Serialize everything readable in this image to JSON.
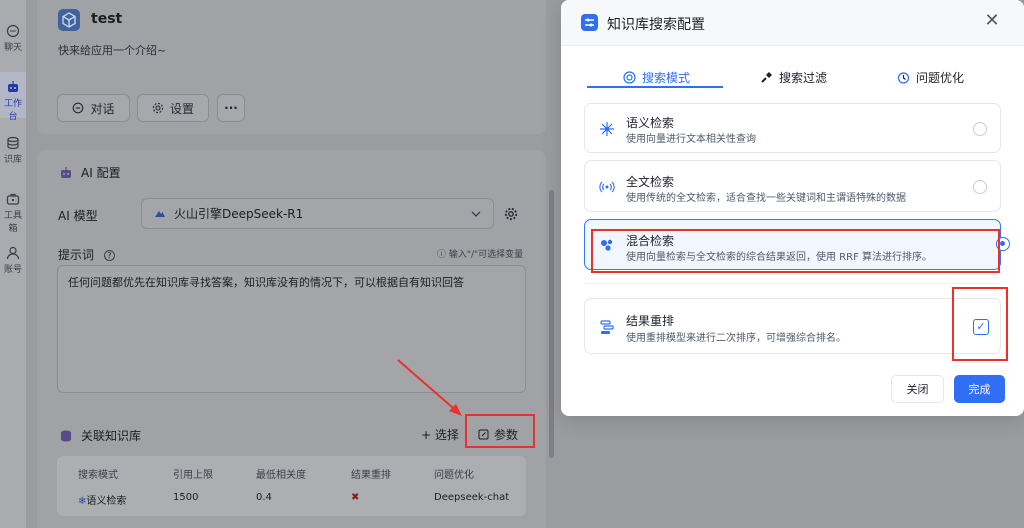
{
  "sidebar": {
    "items": [
      {
        "label": "聊天",
        "icon": "chat-icon"
      },
      {
        "label": "工作台",
        "icon": "robot-icon",
        "active": true
      },
      {
        "label": "识库",
        "icon": "database-icon"
      },
      {
        "label": "工具箱",
        "icon": "toolbox-icon"
      },
      {
        "label": "账号",
        "icon": "user-icon"
      }
    ]
  },
  "app": {
    "name": "test",
    "description": "快来给应用一个介绍~",
    "buttons": {
      "chat": "对话",
      "settings": "设置",
      "more": "···"
    }
  },
  "ai_config": {
    "title": "AI 配置",
    "model_label": "AI 模型",
    "model_value": "火山引擎DeepSeek-R1",
    "prompt_label": "提示词",
    "prompt_hint": "输入\"/\"可选择变量",
    "prompt_text": "任何问题都优先在知识库寻找答案，知识库没有的情况下，可以根据自有知识回答"
  },
  "knowledge": {
    "title": "关联知识库",
    "select_label": "+ 选择",
    "params_label": "参数",
    "columns": [
      "搜索模式",
      "引用上限",
      "最低相关度",
      "结果重排",
      "问题优化"
    ],
    "row": {
      "mode": "语义检索",
      "limit": "1500",
      "min_score": "0.4",
      "rerank": "✖",
      "optimize": "Deepseek-chat"
    }
  },
  "modal": {
    "title": "知识库搜索配置",
    "close_glyph": "✕",
    "tabs": [
      {
        "label": "搜索模式",
        "active": true
      },
      {
        "label": "搜索过滤"
      },
      {
        "label": "问题优化"
      }
    ],
    "options": [
      {
        "name": "语义检索",
        "desc": "使用向量进行文本相关性查询",
        "icon": "semantic-icon",
        "selected": false
      },
      {
        "name": "全文检索",
        "desc": "使用传统的全文检索，适合查找一些关键词和主谓语特殊的数据",
        "icon": "fulltext-icon",
        "selected": false
      },
      {
        "name": "混合检索",
        "desc": "使用向量检索与全文检索的综合结果返回，使用 RRF 算法进行排序。",
        "icon": "hybrid-icon",
        "selected": true
      }
    ],
    "rerank": {
      "name": "结果重排",
      "desc": "使用重排模型来进行二次排序，可增强综合排名。",
      "checked": true,
      "check_glyph": "✓"
    },
    "footer": {
      "close": "关闭",
      "done": "完成"
    }
  },
  "colors": {
    "accent": "#2f6ef5",
    "highlight": "#e8322b",
    "overlay": "#9a9ca0"
  }
}
